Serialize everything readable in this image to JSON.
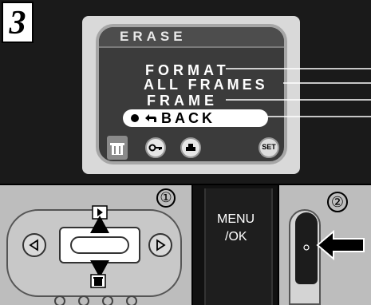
{
  "step": {
    "number": "3"
  },
  "lcd": {
    "title": "ERASE",
    "items": {
      "format": "FORMAT",
      "all_frames": "ALL  FRAMES",
      "frame": "FRAME",
      "back": "BACK"
    },
    "set_button": "SET"
  },
  "controls": {
    "step1_marker": "①",
    "step2_marker": "②",
    "menu_ok_line1": "MENU",
    "menu_ok_line2": "/OK"
  },
  "colors": {
    "lcd_background": "#3b3b3b",
    "highlight": "#ffffff",
    "panel_gray": "#bdbdbd"
  }
}
